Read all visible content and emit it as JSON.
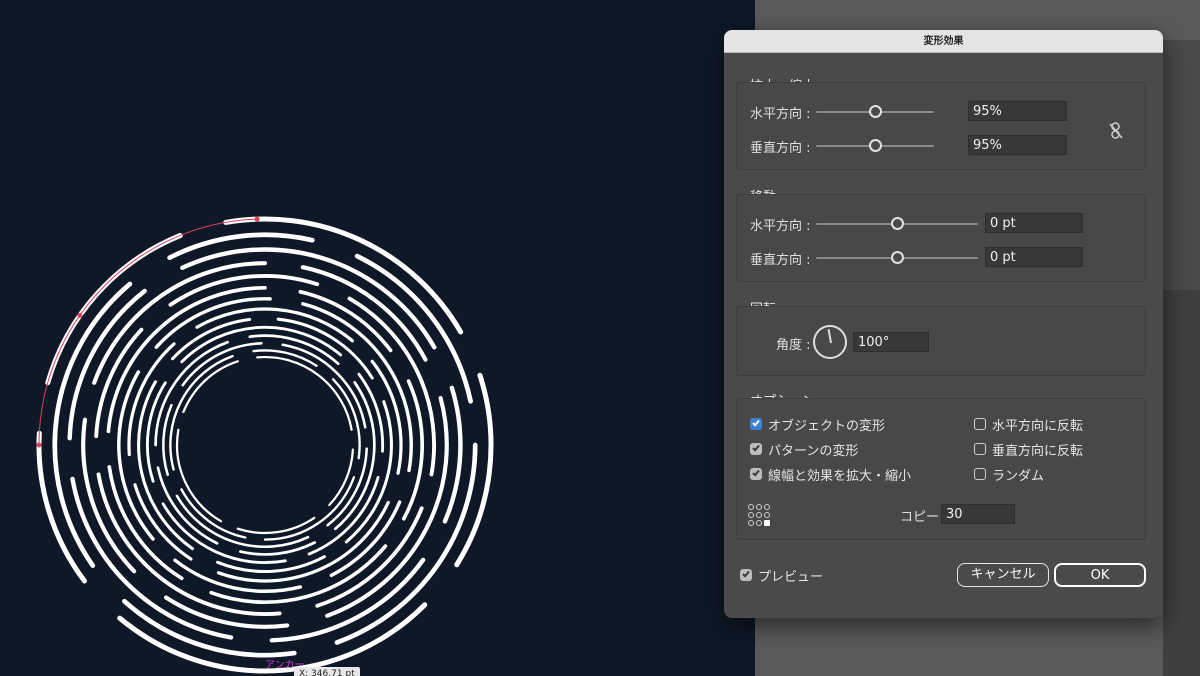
{
  "dialog": {
    "title": "変形効果",
    "scale": {
      "title": "拡大・縮小",
      "horizontal_label": "水平方向 :",
      "horizontal_value": "95%",
      "horizontal_slider": 0.5,
      "vertical_label": "垂直方向 :",
      "vertical_value": "95%",
      "vertical_slider": 0.5,
      "link_icon": "unlink-icon"
    },
    "move": {
      "title": "移動",
      "horizontal_label": "水平方向 :",
      "horizontal_value": "0 pt",
      "horizontal_slider": 0.5,
      "vertical_label": "垂直方向 :",
      "vertical_value": "0 pt",
      "vertical_slider": 0.5
    },
    "rotate": {
      "title": "回転",
      "angle_label": "角度 :",
      "angle_value": "100°"
    },
    "options": {
      "title": "オプション",
      "transform_objects": "オブジェクトの変形",
      "transform_patterns": "パターンの変形",
      "scale_strokes": "線幅と効果を拡大・縮小",
      "reflect_x": "水平方向に反転",
      "reflect_y": "垂直方向に反転",
      "random": "ランダム",
      "copies_label": "コピー",
      "copies_value": "30"
    },
    "preview_label": "プレビュー",
    "cancel_label": "キャンセル",
    "ok_label": "OK"
  },
  "canvas": {
    "anchor_label": "アンカー",
    "coord_readout": "X: 346.71 pt",
    "stroke_color": "#ffffff",
    "background_color": "#0e1826",
    "selection_color": "#e0405a"
  }
}
